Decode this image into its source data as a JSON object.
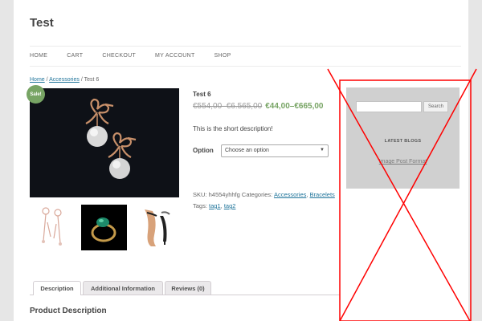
{
  "site": {
    "title": "Test"
  },
  "nav": {
    "items": [
      "HOME",
      "CART",
      "CHECKOUT",
      "MY ACCOUNT",
      "SHOP"
    ]
  },
  "breadcrumb": {
    "home": "Home",
    "sep": " / ",
    "category": "Accessories",
    "current": "Test 6"
  },
  "product": {
    "sale_badge": "Sale!",
    "title": "Test 6",
    "old_price": "€554,00–€6.565,00",
    "new_price": "€44,00–€665,00",
    "short_description": "This is the short description!",
    "option_label": "Option",
    "option_select": "Choose an option",
    "sku_label": "SKU:",
    "sku_value": "h4554yhhfg",
    "categories_label": "Categories:",
    "categories": [
      "Accessories",
      "Bracelets"
    ],
    "tags_label": "Tags:",
    "tags": [
      "tag1",
      "tag2"
    ]
  },
  "sidebar": {
    "search_placeholder": "",
    "search_button": "Search",
    "widget_title": "LATEST BLOGS",
    "widget_link": "Image Post Format"
  },
  "tabs": {
    "items": [
      "Description",
      "Additional Information",
      "Reviews (0)"
    ],
    "active_index": 0
  },
  "content": {
    "heading": "Product Description"
  },
  "colors": {
    "price_green": "#77a464",
    "link_blue": "#21759b",
    "x_red": "#ff0000",
    "sidebar_gray": "#d0d0d0"
  }
}
